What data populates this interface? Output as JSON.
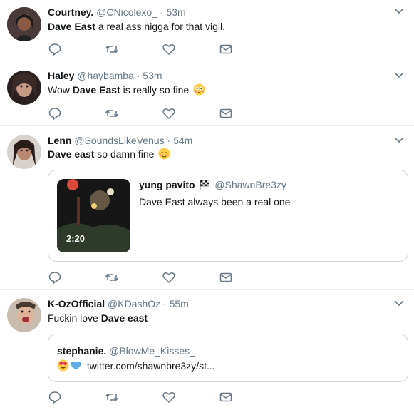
{
  "tweets": [
    {
      "name": "Courtney.",
      "handle": "@CNicolexo_",
      "sep": "·",
      "time": "53m",
      "text_pre": "",
      "text_bold": "Dave East",
      "text_post": " a real ass nigga for that vigil."
    },
    {
      "name": "Haley",
      "handle": "@haybamba",
      "sep": "·",
      "time": "53m",
      "text_pre": "Wow ",
      "text_bold": "Dave East",
      "text_post": " is really so fine ",
      "emoji": "flushed-face-emoji"
    },
    {
      "name": "Lenn",
      "handle": "@SoundsLikeVenus",
      "sep": "·",
      "time": "54m",
      "text_pre": "",
      "text_bold": "Dave east",
      "text_post": " so damn fine ",
      "emoji": "relieved-face-emoji",
      "quote": {
        "name": "yung pavito",
        "flag": "checkered-flag-emoji",
        "handle": "@ShawnBre3zy",
        "text": "Dave East always been a real one",
        "duration": "2:20"
      }
    },
    {
      "name": "K-OzOfficial",
      "handle": "@KDashOz",
      "sep": "·",
      "time": "55m",
      "text_pre": "Fuckin love ",
      "text_bold": "Dave east",
      "text_post": "",
      "quote": {
        "name": "stephanie.",
        "handle": "@BlowMe_Kisses_",
        "emojis": [
          "smiling-face-with-heart-eyes-emoji",
          "blue-heart-emoji"
        ],
        "link": "twitter.com/shawnbre3zy/st..."
      }
    }
  ],
  "icons": {
    "reply": "reply-icon",
    "retweet": "retweet-icon",
    "like": "like-icon",
    "dm": "direct-message-icon",
    "more": "chevron-down-icon"
  },
  "colors": {
    "icon_gray": "#657786",
    "border": "#e6ecf0",
    "quote_border": "#ccd6dd"
  }
}
